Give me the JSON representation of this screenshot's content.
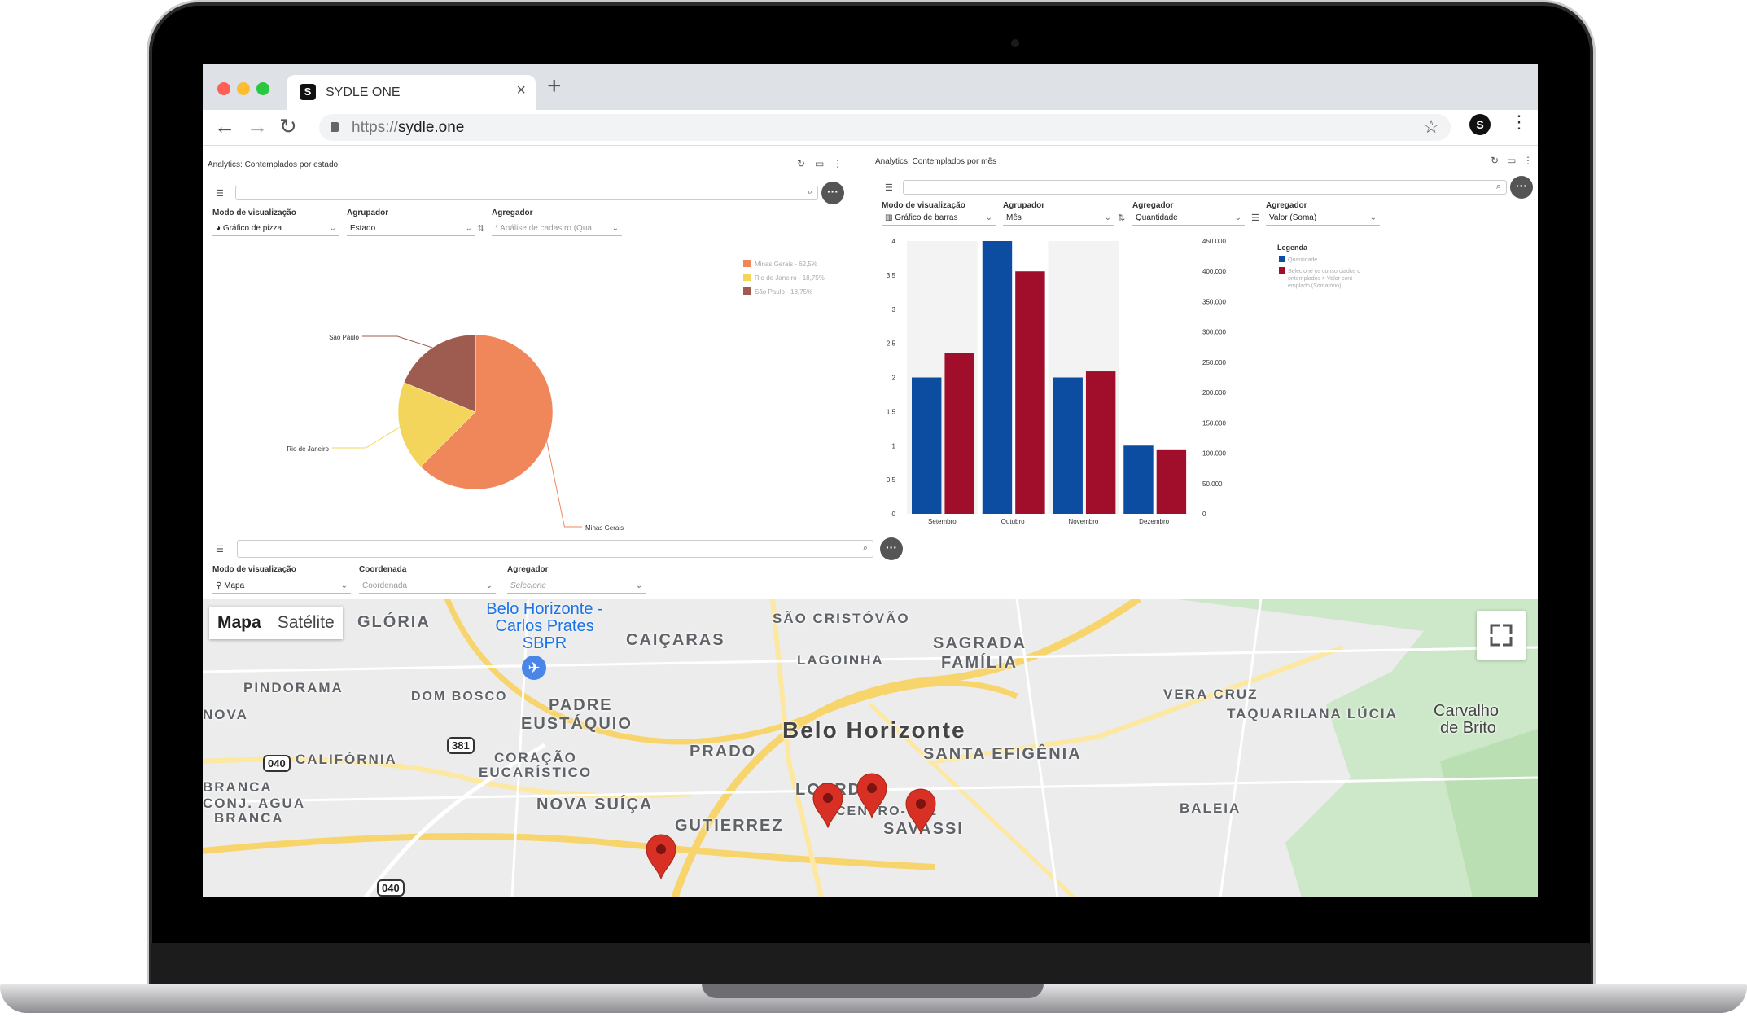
{
  "browser": {
    "tab_title": "SYDLE ONE",
    "tab_logo": "S",
    "url_scheme": "https://",
    "url_host": "sydle.one",
    "profile_initial": "S"
  },
  "panel_states": {
    "title": "Analytics: Contemplados por estado",
    "view_mode_label": "Modo de visualização",
    "view_mode_value": "Gráfico de pizza",
    "grouper_label": "Agrupador",
    "grouper_value": "Estado",
    "aggregator_label": "Agregador",
    "aggregator_placeholder": "* Análise de cadastro (Qua..."
  },
  "panel_months": {
    "title": "Analytics: Contemplados por mês",
    "view_mode_label": "Modo de visualização",
    "view_mode_value": "Gráfico de barras",
    "grouper_label": "Agrupador",
    "grouper_value": "Mês",
    "aggregator1_label": "Agregador",
    "aggregator1_value": "Quantidade",
    "aggregator2_label": "Agregador",
    "aggregator2_value": "Valor (Soma)",
    "legend_title": "Legenda"
  },
  "panel_map": {
    "view_mode_label": "Modo de visualização",
    "view_mode_value": "Mapa",
    "coordinate_label": "Coordenada",
    "coordinate_placeholder": "Coordenada",
    "aggregator_label": "Agregador",
    "aggregator_placeholder": "Selecione",
    "map_type_map": "Mapa",
    "map_type_satellite": "Satélite"
  },
  "map_labels": [
    "GLÓRIA",
    "CAIÇARAS",
    "SÃO CRISTÓVÃO",
    "SAGRADA",
    "FAMÍLIA",
    "LAGOINHA",
    "PINDORAMA",
    "DOM BOSCO",
    "PADRE",
    "EUSTÁQUIO",
    "VERA CRUZ",
    "TAQUARIL",
    "ANA LÚCIA",
    "NOVA",
    "CALIFÓRNIA",
    "PRADO",
    "Belo Horizonte",
    "SANTA EFIGÊNIA",
    "CORAÇÃO",
    "EUCARÍSTICO",
    "LOURDES",
    "BRANCA",
    "CONJ. AGUA",
    "BRANCA",
    "NOVA SUÍÇA",
    "GUTIERREZ",
    "CENTRO-SUL",
    "SAVASSI",
    "BALEIA",
    "Carvalho",
    "de Brito"
  ],
  "map_airport": "Belo Horizonte - Carlos Prates SBPR",
  "map_shields": [
    "381",
    "040",
    "040"
  ],
  "chart_data": [
    {
      "type": "pie",
      "title": "",
      "slices": [
        {
          "label": "Minas Gerais",
          "legend": "Minas Gerais - 62,5%",
          "value": 62.5,
          "color": "#f0875a"
        },
        {
          "label": "Rio de Janeiro",
          "legend": "Rio de Janeiro - 18,75%",
          "value": 18.75,
          "color": "#f3d55b"
        },
        {
          "label": "São Paulo",
          "legend": "São Paulo - 18,75%",
          "value": 18.75,
          "color": "#9e5b4f"
        }
      ]
    },
    {
      "type": "bar",
      "categories": [
        "Setembro",
        "Outubro",
        "Novembro",
        "Dezembro"
      ],
      "series": [
        {
          "name": "Quantidade",
          "values": [
            2,
            4,
            2,
            1
          ],
          "color": "#0c4da2",
          "axis": "left"
        },
        {
          "name": "Selecione os consorciados contemplados > Valor contemplado (Somatório)",
          "values": [
            265000,
            400000,
            235000,
            105000
          ],
          "color": "#a00e2b",
          "axis": "right"
        }
      ],
      "ylim_left": [
        0,
        4
      ],
      "yticks_left": [
        "0",
        "0,5",
        "1",
        "1,5",
        "2",
        "2,5",
        "3",
        "3,5",
        "4"
      ],
      "ylim_right": [
        0,
        450000
      ],
      "yticks_right": [
        "0",
        "50.000",
        "100.000",
        "150.000",
        "200.000",
        "250.000",
        "300.000",
        "350.000",
        "400.000",
        "450.000"
      ],
      "legend_position": "right"
    }
  ]
}
